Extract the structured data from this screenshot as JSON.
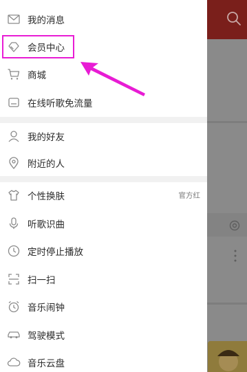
{
  "colors": {
    "accent_highlight": "#e81cd4",
    "icon_gray": "#8a8a8a",
    "text_main": "#2b2b2b",
    "text_secondary": "#7a7a7a",
    "section_gap": "#f1f1f1",
    "overlay": "#8a8a8a"
  },
  "menu": {
    "section1": [
      {
        "label": "我的消息",
        "icon": "mail-icon"
      },
      {
        "label": "会员中心",
        "icon": "vip-diamond-icon"
      },
      {
        "label": "商城",
        "icon": "cart-icon"
      },
      {
        "label": "在线听歌免流量",
        "icon": "sim-card-icon"
      }
    ],
    "section2": [
      {
        "label": "我的好友",
        "icon": "person-icon"
      },
      {
        "label": "附近的人",
        "icon": "location-pin-icon"
      }
    ],
    "section3": [
      {
        "label": "个性换肤",
        "icon": "tshirt-icon",
        "extra": "官方红"
      },
      {
        "label": "听歌识曲",
        "icon": "microphone-icon"
      },
      {
        "label": "定时停止播放",
        "icon": "clock-icon"
      },
      {
        "label": "扫一扫",
        "icon": "scan-icon"
      },
      {
        "label": "音乐闹钟",
        "icon": "alarm-clock-icon"
      },
      {
        "label": "驾驶模式",
        "icon": "car-icon"
      },
      {
        "label": "音乐云盘",
        "icon": "cloud-icon"
      }
    ]
  }
}
